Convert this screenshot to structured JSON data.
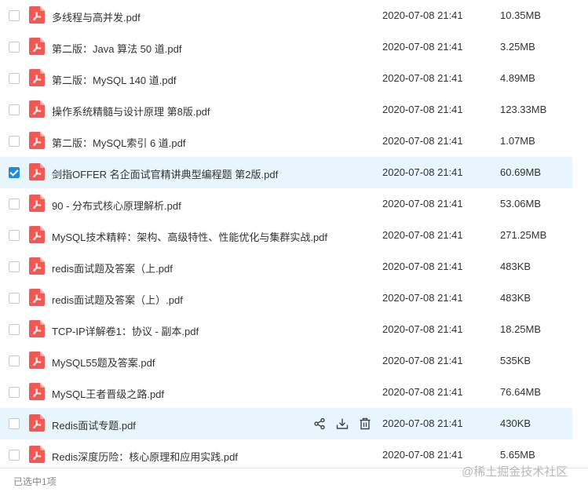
{
  "files": [
    {
      "name": "多线程与高并发.pdf",
      "date": "2020-07-08 21:41",
      "size": "10.35MB",
      "checked": false,
      "state": "normal"
    },
    {
      "name": "第二版：Java  算法 50 道.pdf",
      "date": "2020-07-08 21:41",
      "size": "3.25MB",
      "checked": false,
      "state": "normal"
    },
    {
      "name": "第二版：MySQL 140 道.pdf",
      "date": "2020-07-08 21:41",
      "size": "4.89MB",
      "checked": false,
      "state": "normal"
    },
    {
      "name": "操作系统精髓与设计原理  第8版.pdf",
      "date": "2020-07-08 21:41",
      "size": "123.33MB",
      "checked": false,
      "state": "normal"
    },
    {
      "name": "第二版：MySQL索引 6 道.pdf",
      "date": "2020-07-08 21:41",
      "size": "1.07MB",
      "checked": false,
      "state": "normal"
    },
    {
      "name": "剑指OFFER  名企面试官精讲典型编程题  第2版.pdf",
      "date": "2020-07-08 21:41",
      "size": "60.69MB",
      "checked": true,
      "state": "selected"
    },
    {
      "name": "90 - 分布式核心原理解析.pdf",
      "date": "2020-07-08 21:41",
      "size": "53.06MB",
      "checked": false,
      "state": "normal"
    },
    {
      "name": "MySQL技术精粹：架构、高级特性、性能优化与集群实战.pdf",
      "date": "2020-07-08 21:41",
      "size": "271.25MB",
      "checked": false,
      "state": "normal"
    },
    {
      "name": "redis面试题及答案（上.pdf",
      "date": "2020-07-08 21:41",
      "size": "483KB",
      "checked": false,
      "state": "normal"
    },
    {
      "name": "redis面试题及答案（上）.pdf",
      "date": "2020-07-08 21:41",
      "size": "483KB",
      "checked": false,
      "state": "normal"
    },
    {
      "name": "TCP-IP详解卷1：协议 - 副本.pdf",
      "date": "2020-07-08 21:41",
      "size": "18.25MB",
      "checked": false,
      "state": "normal"
    },
    {
      "name": "MySQL55题及答案.pdf",
      "date": "2020-07-08 21:41",
      "size": "535KB",
      "checked": false,
      "state": "normal"
    },
    {
      "name": "MySQL王者晋级之路.pdf",
      "date": "2020-07-08 21:41",
      "size": "76.64MB",
      "checked": false,
      "state": "normal"
    },
    {
      "name": "Redis面试专题.pdf",
      "date": "2020-07-08 21:41",
      "size": "430KB",
      "checked": false,
      "state": "hover"
    },
    {
      "name": "Redis深度历险：核心原理和应用实践.pdf",
      "date": "2020-07-08 21:41",
      "size": "5.65MB",
      "checked": false,
      "state": "normal"
    }
  ],
  "row_actions": {
    "share_icon": "share-icon",
    "download_icon": "download-icon",
    "delete_icon": "trash-icon"
  },
  "status": {
    "selection_text": "已选中1项"
  },
  "watermark": {
    "text": "@稀土掘金技术社区"
  },
  "colors": {
    "pdf_icon": "#f15a54",
    "selected_bg": "#e8f5fc",
    "checkbox_checked": "#1e88e5"
  }
}
